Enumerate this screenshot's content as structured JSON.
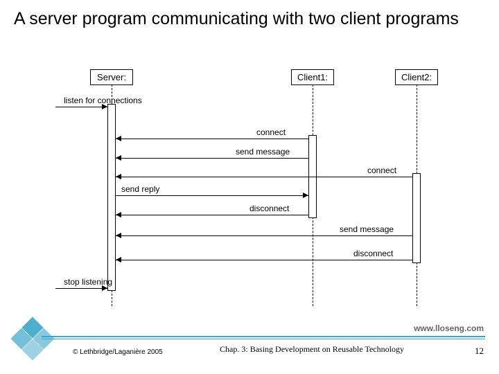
{
  "title": "A server program communicating with two client programs",
  "participants": {
    "server": "Server:",
    "client1": "Client1:",
    "client2": "Client2:"
  },
  "messages": {
    "listen": "listen for connections",
    "connect1": "connect",
    "send_msg1": "send message",
    "connect2": "connect",
    "send_reply": "send reply",
    "disconnect1": "disconnect",
    "send_msg2": "send message",
    "disconnect2": "disconnect",
    "stop": "stop listening"
  },
  "footer": {
    "website": "www.lloseng.com",
    "copyright": "© Lethbridge/Laganière 2005",
    "chapter": "Chap. 3: Basing Development on Reusable Technology",
    "page": "12"
  }
}
